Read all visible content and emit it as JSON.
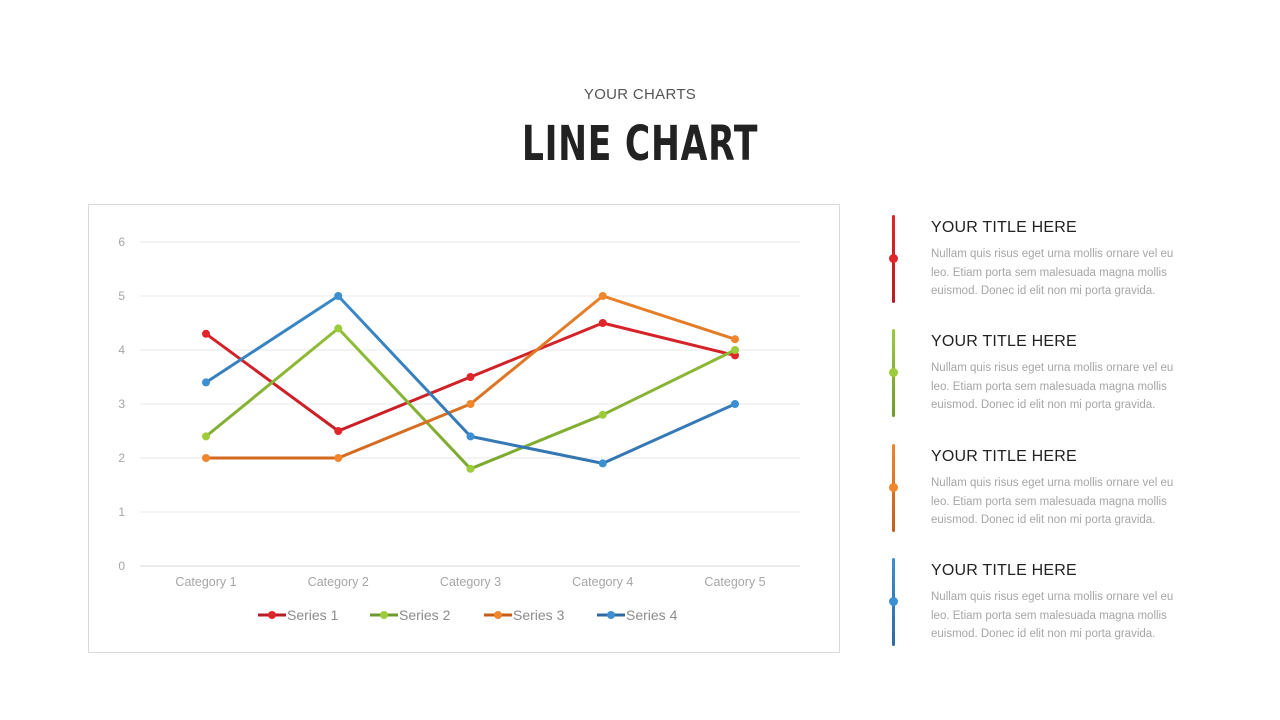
{
  "header": {
    "subtitle": "YOUR CHARTS",
    "title": "LINE CHART"
  },
  "chart_data": {
    "type": "line",
    "title": "",
    "xlabel": "",
    "ylabel": "",
    "categories": [
      "Category 1",
      "Category 2",
      "Category 3",
      "Category 4",
      "Category 5"
    ],
    "y_ticks": [
      0,
      1,
      2,
      3,
      4,
      5,
      6
    ],
    "ylim": [
      0,
      6
    ],
    "grid": true,
    "legend_position": "bottom",
    "series": [
      {
        "name": "Series 1",
        "values": [
          4.3,
          2.5,
          3.5,
          4.5,
          3.9
        ],
        "color": "#e0262b",
        "color_dark": "#b71c22"
      },
      {
        "name": "Series 2",
        "values": [
          2.4,
          4.4,
          1.8,
          2.8,
          4.0
        ],
        "color": "#9ccb3b",
        "color_dark": "#6f9a2c"
      },
      {
        "name": "Series 3",
        "values": [
          2.0,
          2.0,
          3.0,
          5.0,
          4.2
        ],
        "color": "#f0872c",
        "color_dark": "#c45d1a"
      },
      {
        "name": "Series 4",
        "values": [
          3.4,
          5.0,
          2.4,
          1.9,
          3.0
        ],
        "color": "#3c8fd0",
        "color_dark": "#2f6aa3"
      }
    ]
  },
  "items": [
    {
      "title": "YOUR TITLE HERE",
      "text": "Nullam quis risus eget urna mollis ornare vel eu leo. Etiam porta sem malesuada magna mollis euismod. Donec id elit non mi porta gravida.",
      "color": "#e0262b",
      "color_dark": "#b71c22"
    },
    {
      "title": "YOUR TITLE HERE",
      "text": "Nullam quis risus eget urna mollis ornare vel eu leo. Etiam porta sem malesuada magna mollis euismod. Donec id elit non mi porta gravida.",
      "color": "#9ccb3b",
      "color_dark": "#6f9a2c"
    },
    {
      "title": "YOUR TITLE HERE",
      "text": "Nullam quis risus eget urna mollis ornare vel eu leo. Etiam porta sem malesuada magna mollis euismod. Donec id elit non mi porta gravida.",
      "color": "#f0872c",
      "color_dark": "#c45d1a"
    },
    {
      "title": "YOUR TITLE HERE",
      "text": "Nullam quis risus eget urna mollis ornare vel eu leo. Etiam porta sem malesuada magna mollis euismod. Donec id elit non mi porta gravida.",
      "color": "#3c8fd0",
      "color_dark": "#2f6aa3"
    }
  ]
}
